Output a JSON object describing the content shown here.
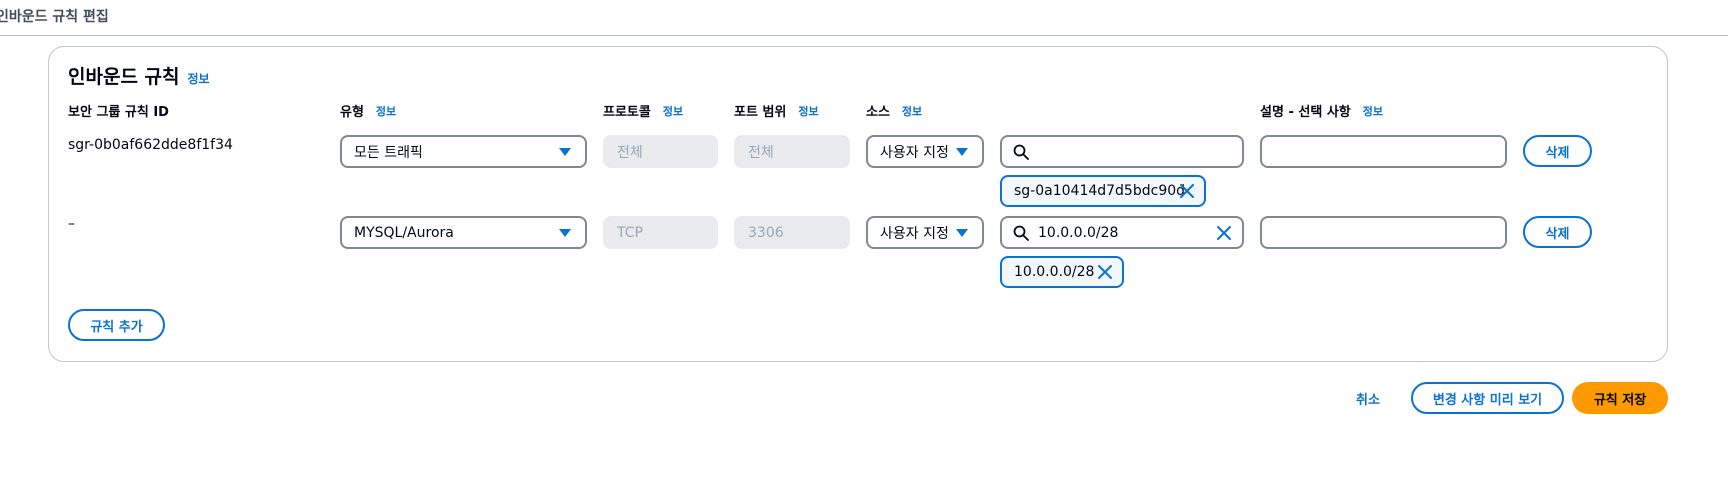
{
  "breadcrumb": "인바운드 규칙 편집",
  "panel": {
    "title": "인바운드 규칙",
    "info_label": "정보"
  },
  "columns": {
    "rule_id": "보안 그룹 규칙 ID",
    "type": "유형",
    "protocol": "프로토콜",
    "port_range": "포트 범위",
    "source": "소스",
    "description": "설명 - 선택 사항",
    "info": "정보"
  },
  "rules": [
    {
      "id": "sgr-0b0af662dde8f1f34",
      "type": "모든 트래픽",
      "protocol": "전체",
      "port_range": "전체",
      "source_type": "사용자 지정",
      "source_search": "",
      "source_token": "sg-0a10414d7d5bdc90d",
      "description": "",
      "delete_label": "삭제"
    },
    {
      "id": "–",
      "type": "MYSQL/Aurora",
      "protocol": "TCP",
      "port_range": "3306",
      "source_type": "사용자 지정",
      "source_search": "10.0.0.0/28",
      "source_token": "10.0.0.0/28",
      "description": "",
      "delete_label": "삭제"
    }
  ],
  "add_rule_label": "규칙 추가",
  "footer": {
    "cancel_label": "취소",
    "preview_label": "변경 사항 미리 보기",
    "save_label": "규칙 저장"
  },
  "colors": {
    "accent": "#0972d3",
    "primary": "#ff9900",
    "disabled_bg": "#e9ebed"
  }
}
